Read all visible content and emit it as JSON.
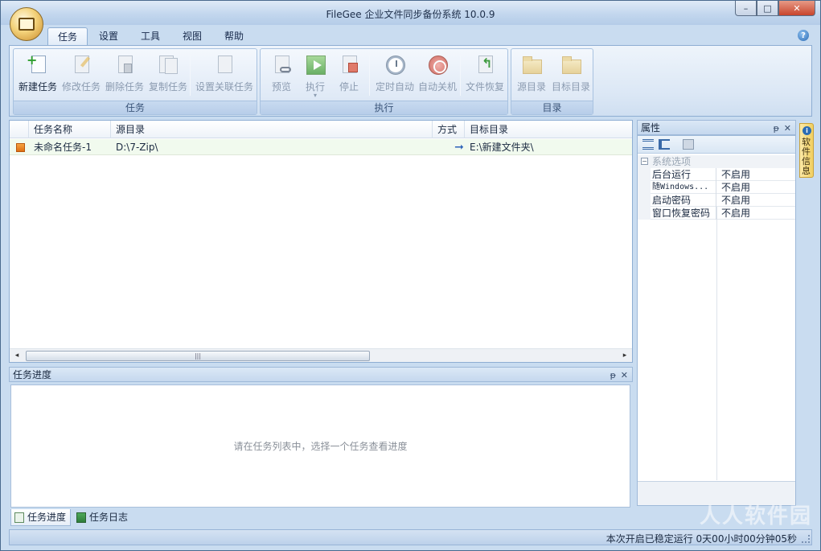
{
  "window": {
    "title": "FileGee 企业文件同步备份系统 10.0.9",
    "controls": {
      "minimize": "–",
      "maximize": "□",
      "close": "✕"
    }
  },
  "ribbon": {
    "tabs": [
      "任务",
      "设置",
      "工具",
      "视图",
      "帮助"
    ],
    "active_tab": "任务",
    "help_glyph": "?",
    "groups": {
      "task": {
        "label": "任务",
        "buttons": {
          "new": "新建任务",
          "edit": "修改任务",
          "delete": "删除任务",
          "copy": "复制任务",
          "link": "设置关联任务"
        }
      },
      "exec": {
        "label": "执行",
        "buttons": {
          "preview": "预览",
          "run": "执行",
          "stop": "停止",
          "scheduled": "定时自动",
          "shutdown": "自动关机",
          "restore": "文件恢复"
        },
        "run_arrow": "▾"
      },
      "dir": {
        "label": "目录",
        "buttons": {
          "source": "源目录",
          "target": "目标目录"
        }
      }
    }
  },
  "task_list": {
    "columns": {
      "name": "任务名称",
      "source": "源目录",
      "mode": "方式",
      "target": "目标目录"
    },
    "rows": [
      {
        "name": "未命名任务-1",
        "source": "D:\\7-Zip\\",
        "mode_glyph": "➞",
        "target": "E:\\新建文件夹\\"
      }
    ],
    "scroll": {
      "left": "◂",
      "right": "▸",
      "thumb_grip": "|||"
    }
  },
  "progress_panel": {
    "title": "任务进度",
    "pin": "ᵽ",
    "close": "✕",
    "hint": "请在任务列表中，选择一个任务查看进度"
  },
  "bottom_tabs": {
    "progress": "任务进度",
    "log": "任务日志"
  },
  "properties": {
    "title": "属性",
    "pin": "ᵽ",
    "close": "✕",
    "category": "系统选项",
    "toggle": "−",
    "items": [
      {
        "key": "后台运行",
        "value": "不启用"
      },
      {
        "key": "随Windows...",
        "value": "不启用"
      },
      {
        "key": "启动密码",
        "value": "不启用"
      },
      {
        "key": "窗口恢复密码",
        "value": "不启用"
      }
    ]
  },
  "side_tab": {
    "icon": "i",
    "label": "软件信息"
  },
  "statusbar": {
    "text": "本次开启已稳定运行 0天00小时00分钟05秒"
  },
  "watermark": "人人软件园",
  "colors": {
    "accent": "#2b6cb5",
    "task_icon": "#df6f12",
    "row_bg": "#f1faee",
    "ribbon_bg": "#dbe7f5"
  }
}
